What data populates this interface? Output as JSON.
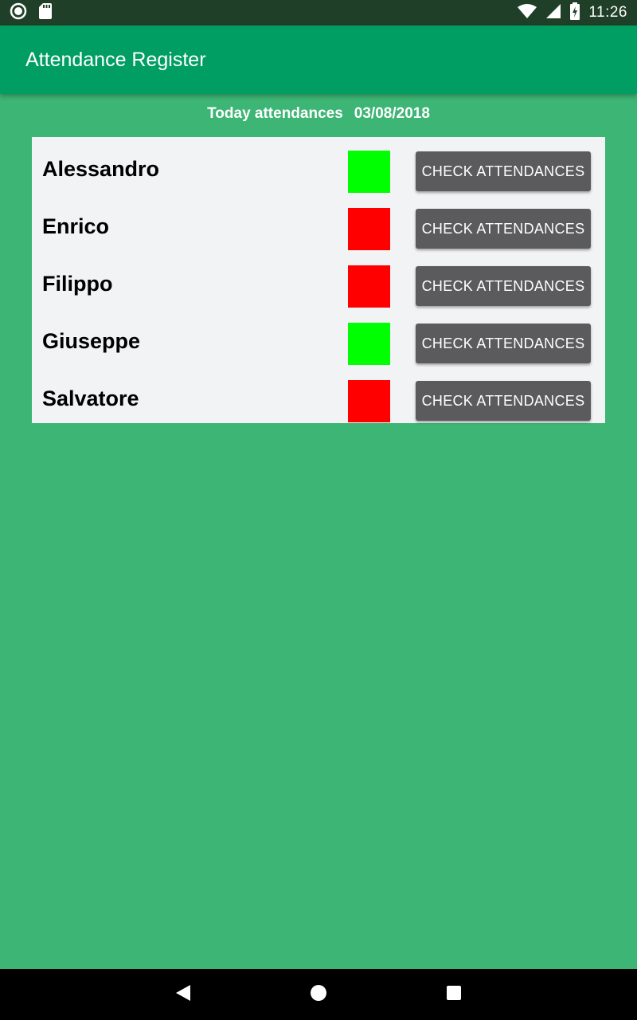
{
  "status_bar": {
    "time": "11:26",
    "icons": [
      "circle-notification-icon",
      "sd-card-icon",
      "wifi-icon",
      "cell-signal-icon",
      "battery-charging-icon"
    ]
  },
  "app_bar": {
    "title": "Attendance Register"
  },
  "header": {
    "label": "Today attendances",
    "date": "03/08/2018"
  },
  "people": [
    {
      "name": "Alessandro",
      "present": true,
      "button": "CHECK ATTENDANCES"
    },
    {
      "name": "Enrico",
      "present": false,
      "button": "CHECK ATTENDANCES"
    },
    {
      "name": "Filippo",
      "present": false,
      "button": "CHECK ATTENDANCES"
    },
    {
      "name": "Giuseppe",
      "present": true,
      "button": "CHECK ATTENDANCES"
    },
    {
      "name": "Salvatore",
      "present": false,
      "button": "CHECK ATTENDANCES"
    }
  ],
  "colors": {
    "present": "#00ff00",
    "absent": "#ff0000",
    "background": "#3db574",
    "app_bar": "#009e63",
    "status_bar": "#203f28",
    "button": "#5b5b5d"
  },
  "nav_bar": {
    "icons": [
      "back-icon",
      "home-icon",
      "recents-icon"
    ]
  }
}
